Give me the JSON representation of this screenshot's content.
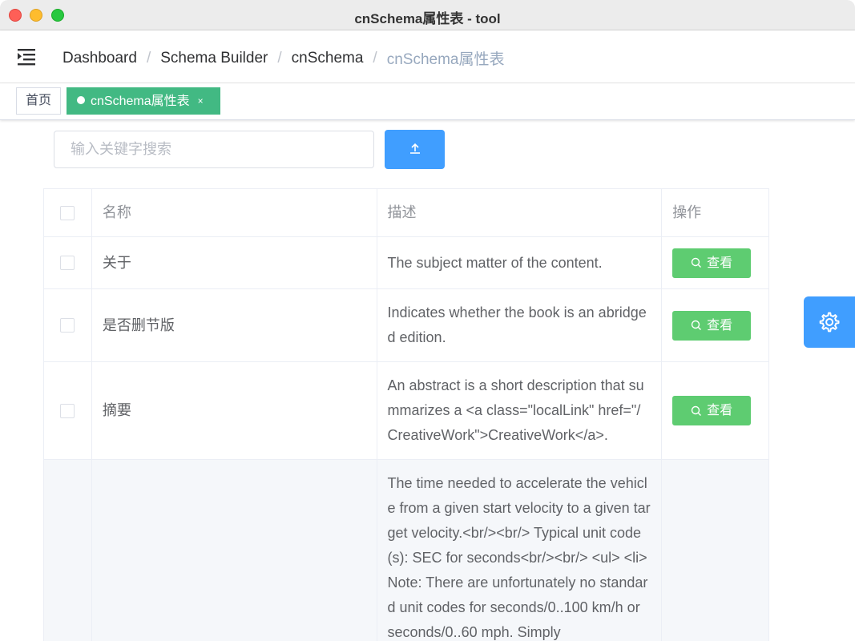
{
  "window": {
    "title": "cnSchema属性表 - tool"
  },
  "breadcrumb": [
    "Dashboard",
    "Schema Builder",
    "cnSchema",
    "cnSchema属性表"
  ],
  "tags": {
    "home": "首页",
    "active": "cnSchema属性表",
    "close": "×"
  },
  "search": {
    "placeholder": "输入关键字搜索",
    "value": ""
  },
  "table": {
    "headers": {
      "name": "名称",
      "desc": "描述",
      "op": "操作"
    },
    "rows": [
      {
        "name": "关于",
        "desc": "The subject matter of the content.",
        "action": "查看"
      },
      {
        "name": "是否删节版",
        "desc": "Indicates whether the book is an abridged edition.",
        "action": "查看"
      },
      {
        "name": "摘要",
        "desc": "An abstract is a short description that summarizes a <a class=\"localLink\" href=\"/CreativeWork\">CreativeWork</a>.",
        "action": "查看"
      },
      {
        "name": "",
        "desc": "The time needed to accelerate the vehicle from a given start velocity to a given target velocity.<br/><br/> Typical unit code(s): SEC for seconds<br/><br/> <ul> <li>Note: There are unfortunately no standard unit codes for seconds/0..100 km/h or seconds/0..60 mph. Simply",
        "action": ""
      }
    ]
  },
  "colors": {
    "primary": "#409eff",
    "success": "#5ecc71",
    "tag_active": "#42b983"
  },
  "icons": [
    "hamburger-icon",
    "upload-icon",
    "search-icon",
    "gear-icon"
  ]
}
